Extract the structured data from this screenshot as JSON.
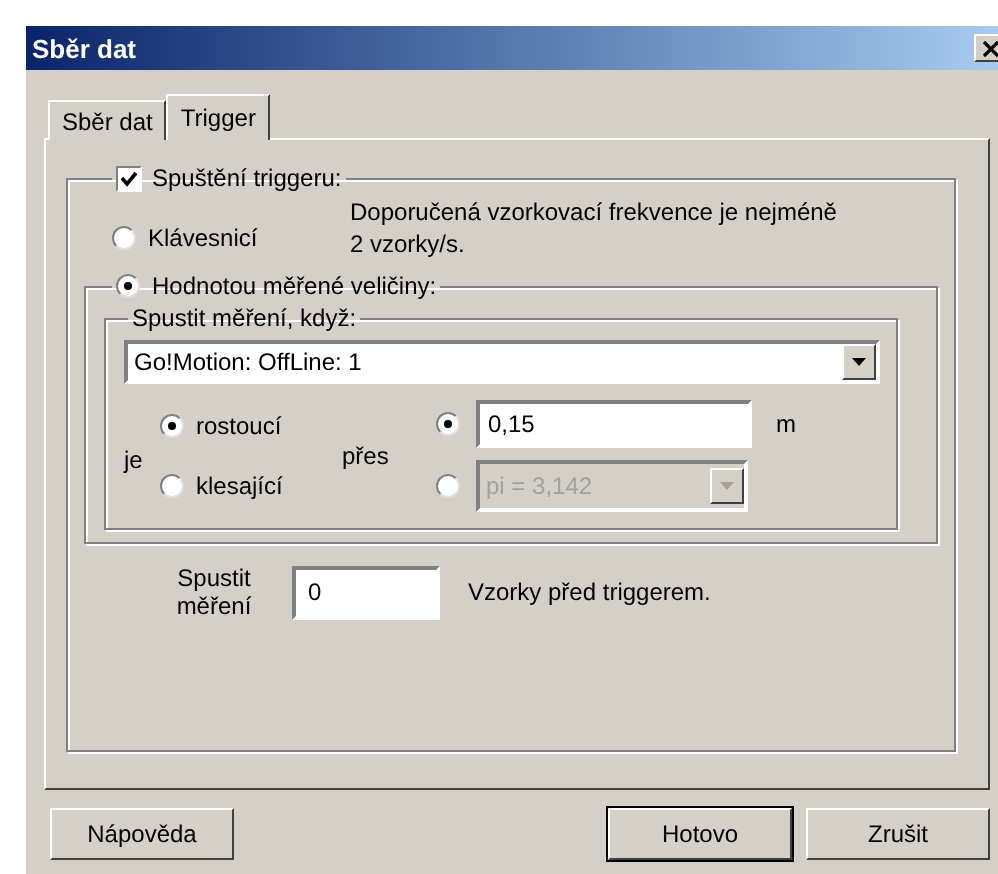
{
  "window": {
    "title": "Sběr dat"
  },
  "tabs": [
    {
      "label": "Sběr dat",
      "selected": false
    },
    {
      "label": "Trigger",
      "selected": true
    }
  ],
  "trigger_checkbox": {
    "label": "Spuštění triggeru:",
    "checked": true
  },
  "hint": "Doporučená vzorkovací frekvence je nejméně 2 vzorky/s.",
  "modes": [
    {
      "label": "Klávesnicí",
      "selected": false
    },
    {
      "label": "Hodnotou měřené veličiny:",
      "selected": true
    }
  ],
  "condition": {
    "title": "Spustit měření, když:",
    "sensor": "Go!Motion: OffLine: 1",
    "direction_label": "je",
    "directions": [
      {
        "label": "rostoucí",
        "selected": true
      },
      {
        "label": "klesající",
        "selected": false
      }
    ],
    "threshold_label": "přes",
    "thresholds": [
      {
        "kind": "input",
        "value": "0,15",
        "unit": "m",
        "selected": true,
        "disabled": false
      },
      {
        "kind": "dropdown",
        "value": "pi = 3,142",
        "selected": false,
        "disabled": true
      }
    ]
  },
  "pre_samples": {
    "label": "Spustit měření",
    "value": "0",
    "suffix": "Vzorky před triggerem."
  },
  "buttons": [
    {
      "label": "Nápověda",
      "default": false
    },
    {
      "label": "Hotovo",
      "default": true
    },
    {
      "label": "Zrušit",
      "default": false
    }
  ]
}
